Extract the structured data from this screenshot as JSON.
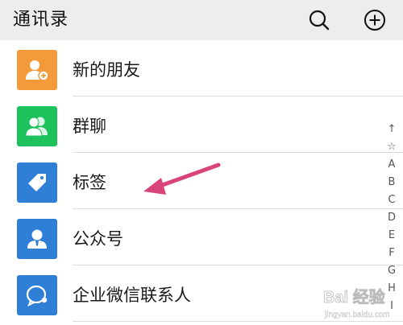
{
  "header": {
    "title": "通讯录",
    "search_icon": "search-icon",
    "add_icon": "plus-circle-icon"
  },
  "items": [
    {
      "label": "新的朋友",
      "icon": "add-friend-icon",
      "color": "#f39a3b"
    },
    {
      "label": "群聊",
      "icon": "group-chat-icon",
      "color": "#1ec25d"
    },
    {
      "label": "标签",
      "icon": "tag-icon",
      "color": "#2f7fd7"
    },
    {
      "label": "公众号",
      "icon": "official-account-icon",
      "color": "#2f7fd7"
    },
    {
      "label": "企业微信联系人",
      "icon": "wecom-contact-icon",
      "color": "#2f7fd7"
    }
  ],
  "index": [
    "↑",
    "☆",
    "A",
    "B",
    "C",
    "D",
    "E",
    "F",
    "G",
    "H",
    "I"
  ],
  "annotation": {
    "arrow_color": "#d9447a"
  },
  "watermark": {
    "text": "Bai 经验",
    "url": "jingyan.baidu.com"
  }
}
